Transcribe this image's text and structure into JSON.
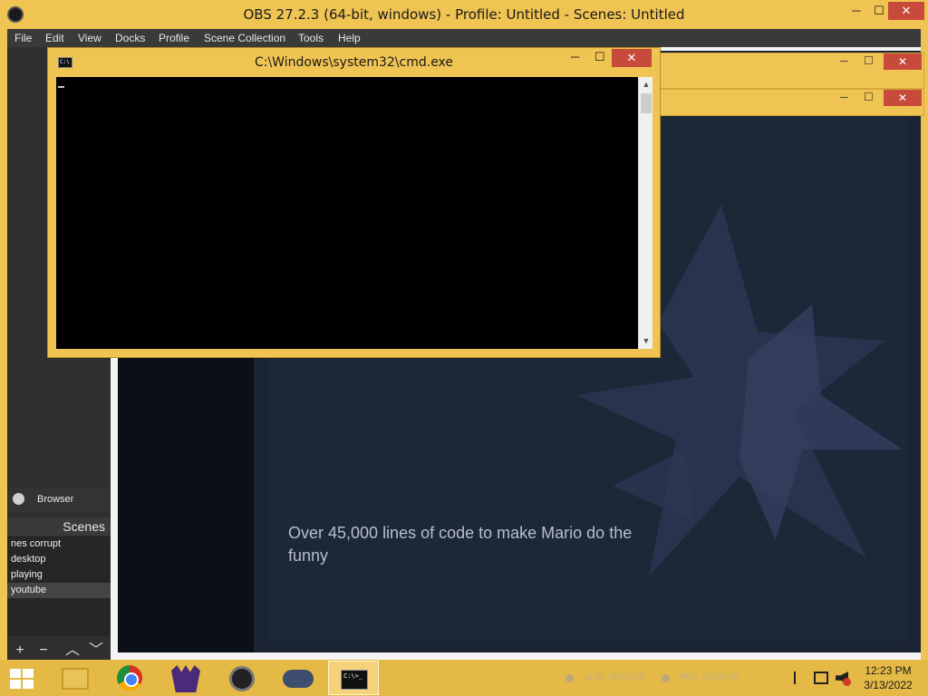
{
  "obs": {
    "title": "OBS 27.2.3 (64-bit, windows) - Profile: Untitled - Scenes: Untitled",
    "window_controls": {
      "minimize": "─",
      "maximize": "☐",
      "close": "✕"
    },
    "menu": [
      "File",
      "Edit",
      "View",
      "Docks",
      "Profile",
      "Scene Collection",
      "Tools",
      "Help"
    ],
    "browser_source_label": "Browser",
    "scenes_title": "Scenes",
    "scenes": [
      "nes corrupt",
      "desktop",
      "playing",
      "youtube"
    ],
    "selected_scene": "youtube",
    "scene_tools": {
      "add": "+",
      "remove": "−",
      "up": "︿",
      "down": "﹀"
    },
    "preview_caption": "Over 45,000 lines of code to make Mario do the funny"
  },
  "background_windows": {
    "controls": {
      "minimize": "─",
      "maximize": "☐",
      "close": "✕"
    }
  },
  "cmd": {
    "title": "C:\\Windows\\system32\\cmd.exe",
    "icon_text": "C:\\",
    "controls": {
      "minimize": "─",
      "maximize": "☐",
      "close": "✕"
    },
    "scroll_up": "▲",
    "scroll_down": "▼"
  },
  "taskbar": {
    "apps": [
      "start",
      "file-explorer",
      "chrome",
      "game",
      "obs",
      "cloud-app",
      "cmd"
    ],
    "active_app": "cmd",
    "cmd_icon_text": "C:\\>_",
    "live_status": "LIVE: 00:00:00",
    "rec_status": "REC: 00:00:00",
    "clock_time": "12:23 PM",
    "clock_date": "3/13/2022"
  },
  "colors": {
    "window_frame": "#f0c452",
    "close_button": "#c74a3a",
    "obs_dark": "#2f2f2f",
    "console_bg": "#000000",
    "taskbar": "#e4b945"
  }
}
